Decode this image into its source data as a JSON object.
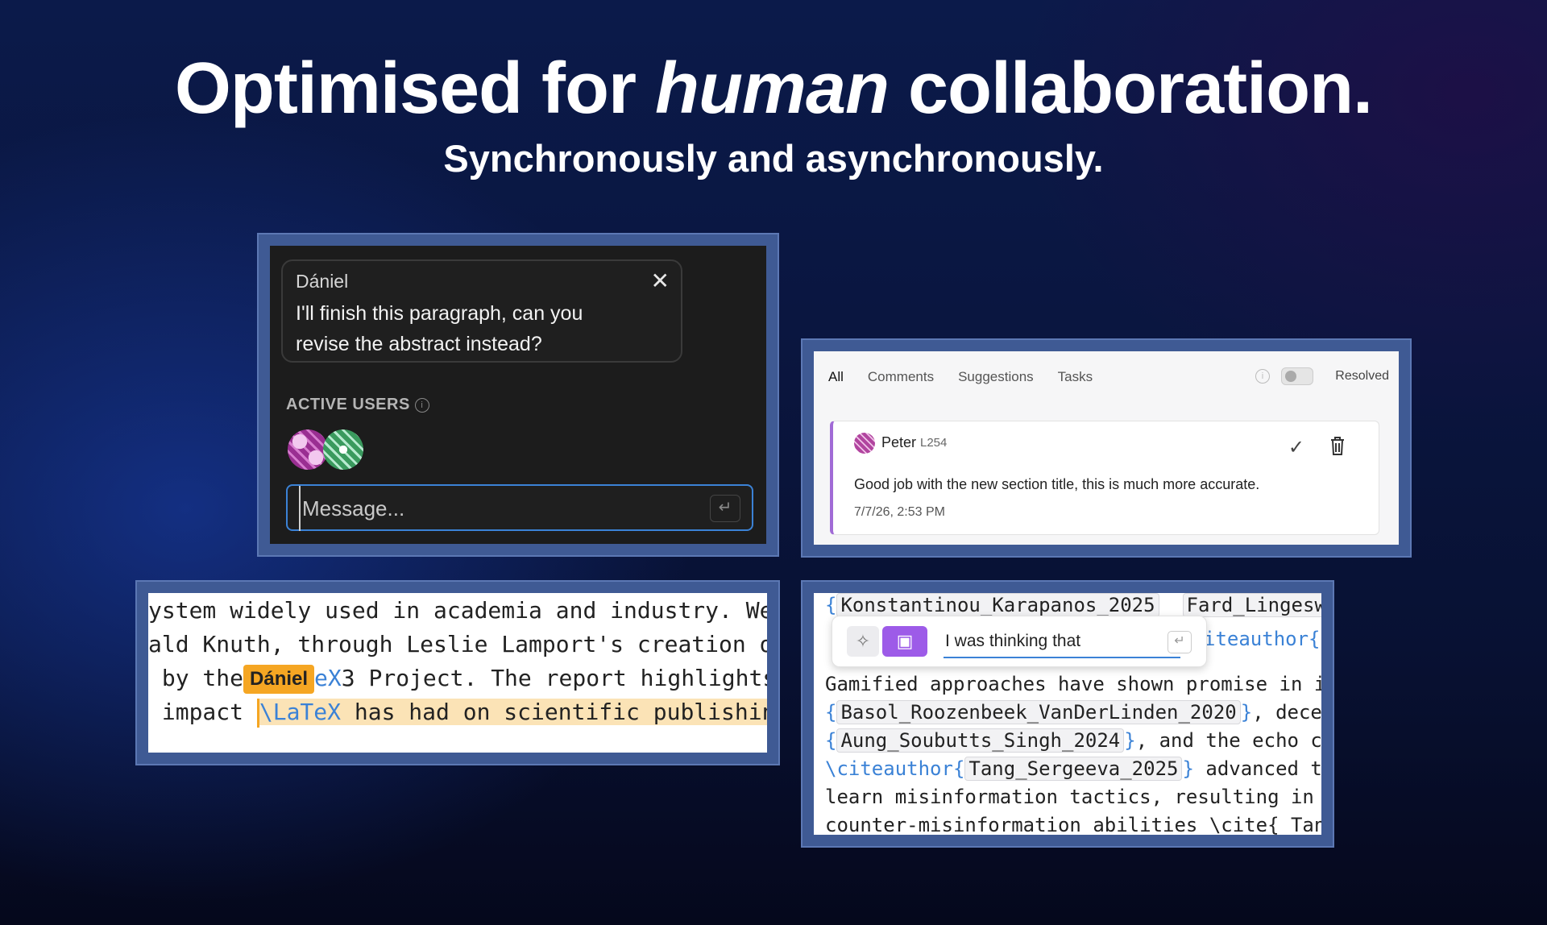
{
  "headline": {
    "part1": "Optimised for ",
    "emphasis": "human",
    "part2": " collaboration."
  },
  "subheadline": "Synchronously and asynchronously.",
  "chat_panel": {
    "bubble": {
      "author": "Dániel",
      "message": "I'll finish this paragraph, can you revise the abstract instead?",
      "close_icon": "close-icon"
    },
    "active_users_label": "ACTIVE USERS",
    "message_placeholder": "Message...",
    "send_icon": "enter-icon"
  },
  "comments_panel": {
    "tabs": [
      "All",
      "Comments",
      "Suggestions",
      "Tasks"
    ],
    "active_tab": "All",
    "resolved_label": "Resolved",
    "comment": {
      "author": "Peter",
      "line": "L254",
      "text": "Good job with the new section title, this is much more accurate.",
      "timestamp": "7/7/26, 2:53 PM"
    },
    "accent_color": "#a16bd6"
  },
  "code_panel": {
    "line1": "ystem widely used in academia and industry. We",
    "line2": "ald Knuth, through Leslie Lamport's creation o",
    "line3_prefix": " by the",
    "cursor_label": "Dániel",
    "line3_blue": "eX",
    "line3_rest": "3 Project. The report highlights",
    "line4_prefix": " impact ",
    "line4_blue": "\\LaTeX",
    "line4_rest": " has had on scientific publishing",
    "cursor_color": "#f5a623"
  },
  "editor_panel": {
    "top_cite1": "Konstantinou_Karapanos_2025",
    "top_cite2": "Fard_Lingesw",
    "right_fragment": "iteauthor{",
    "prompt_value": "I was thinking that",
    "line1": "Gamified approaches have shown promise in inc",
    "line2_cite": "Basol_Roozenbeek_VanDerLinden_2020",
    "line2_rest": ", dece",
    "line3_cite": "Aung_Soubutts_Singh_2024",
    "line3_rest": ", and the echo c",
    "line4_cmd": "\\citeauthor{",
    "line4_cite": "Tang_Sergeeva_2025",
    "line4_rest": " advanced t",
    "line5": "learn misinformation tactics, resulting in l",
    "line6": "counter-misinformation abilities \\cite{ Tang"
  }
}
